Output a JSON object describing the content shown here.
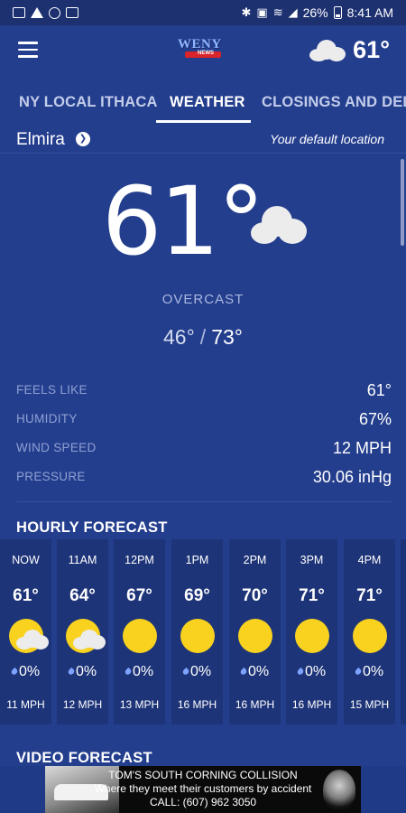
{
  "status_bar": {
    "battery": "26%",
    "time": "8:41 AM"
  },
  "header": {
    "logo_text": "WENY",
    "logo_sub": "NEWS",
    "current_temp": "61°",
    "weather_icon": "cloud-icon"
  },
  "tabs": [
    {
      "label": "NY LOCAL ITHACA",
      "active": false
    },
    {
      "label": "WEATHER",
      "active": true
    },
    {
      "label": "CLOSINGS AND DELAYS",
      "active": false
    }
  ],
  "location": {
    "name": "Elmira",
    "default_label": "Your default location"
  },
  "current": {
    "temp": "61°",
    "condition": "OVERCAST",
    "low": "46°",
    "separator": "/",
    "high": "73°",
    "icon": "cloud-icon"
  },
  "details": [
    {
      "label": "FEELS LIKE",
      "value": "61°"
    },
    {
      "label": "HUMIDITY",
      "value": "67%"
    },
    {
      "label": "WIND SPEED",
      "value": "12 MPH"
    },
    {
      "label": "PRESSURE",
      "value": "30.06 inHg"
    }
  ],
  "hourly": {
    "title": "HOURLY FORECAST",
    "items": [
      {
        "hour": "NOW",
        "temp": "61°",
        "icon": "partly-sunny-icon",
        "precip": "0%",
        "wind": "11 MPH"
      },
      {
        "hour": "11AM",
        "temp": "64°",
        "icon": "partly-sunny-icon",
        "precip": "0%",
        "wind": "12 MPH"
      },
      {
        "hour": "12PM",
        "temp": "67°",
        "icon": "sun-icon",
        "precip": "0%",
        "wind": "13 MPH"
      },
      {
        "hour": "1PM",
        "temp": "69°",
        "icon": "sun-icon",
        "precip": "0%",
        "wind": "16 MPH"
      },
      {
        "hour": "2PM",
        "temp": "70°",
        "icon": "sun-icon",
        "precip": "0%",
        "wind": "16 MPH"
      },
      {
        "hour": "3PM",
        "temp": "71°",
        "icon": "sun-icon",
        "precip": "0%",
        "wind": "16 MPH"
      },
      {
        "hour": "4PM",
        "temp": "71°",
        "icon": "sun-icon",
        "precip": "0%",
        "wind": "15 MPH"
      }
    ]
  },
  "video": {
    "title": "VIDEO FORECAST"
  },
  "ad": {
    "line1": "TOM'S SOUTH CORNING COLLISION",
    "line2": "Where they meet their customers by accident",
    "line3": "CALL: (607) 962 3050"
  },
  "colors": {
    "background": "#243e8e",
    "card": "#1e3478",
    "sun": "#f8d21f",
    "accent": "#ffffff"
  }
}
